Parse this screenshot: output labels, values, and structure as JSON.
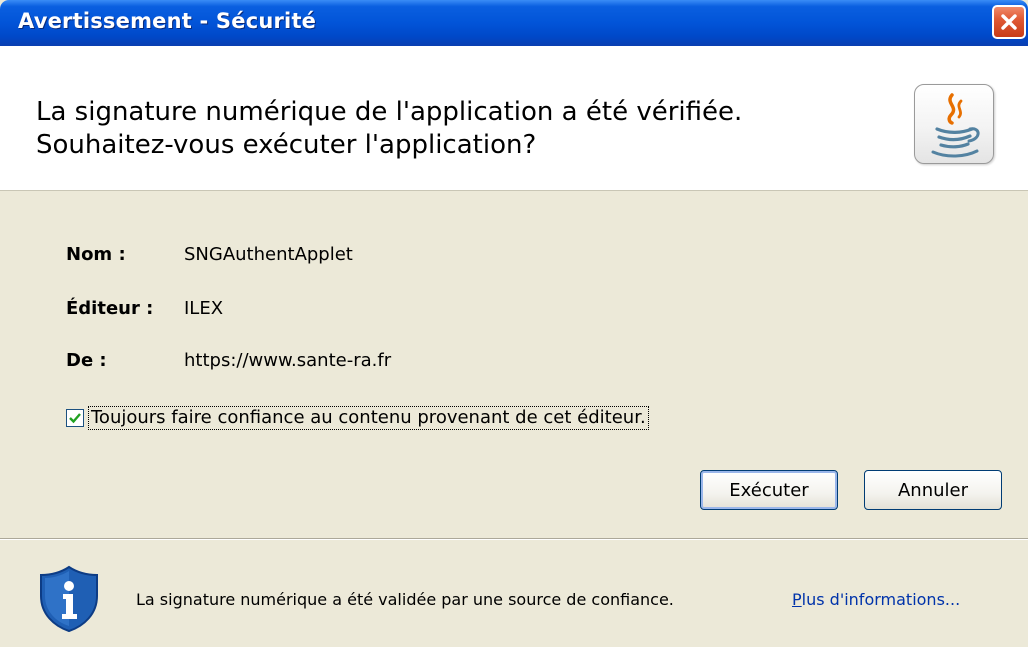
{
  "window": {
    "title": "Avertissement - Sécurité",
    "close_icon": "close-icon"
  },
  "header": {
    "line1": "La signature numérique de l'application a été vérifiée.",
    "line2": "Souhaitez-vous exécuter l'application?",
    "logo": "java-logo-icon"
  },
  "details": {
    "name_label": "Nom :",
    "name_value": "SNGAuthentApplet",
    "publisher_label": "Éditeur :",
    "publisher_value": "ILEX",
    "from_label": "De :",
    "from_value": "https://www.sante-ra.fr"
  },
  "trust_checkbox": {
    "label": "Toujours faire confiance au contenu provenant de cet éditeur.",
    "checked": true
  },
  "buttons": {
    "run": "Exécuter",
    "cancel": "Annuler"
  },
  "footer": {
    "icon": "shield-info-icon",
    "message": "La signature numérique a été validée par une source de confiance.",
    "more_info": "Plus d'informations..."
  },
  "colors": {
    "titlebar": "#0254d8",
    "close": "#e05a36",
    "dialog_bg": "#ece9d8",
    "link": "#0033aa",
    "shield": "#1f5fb4"
  }
}
